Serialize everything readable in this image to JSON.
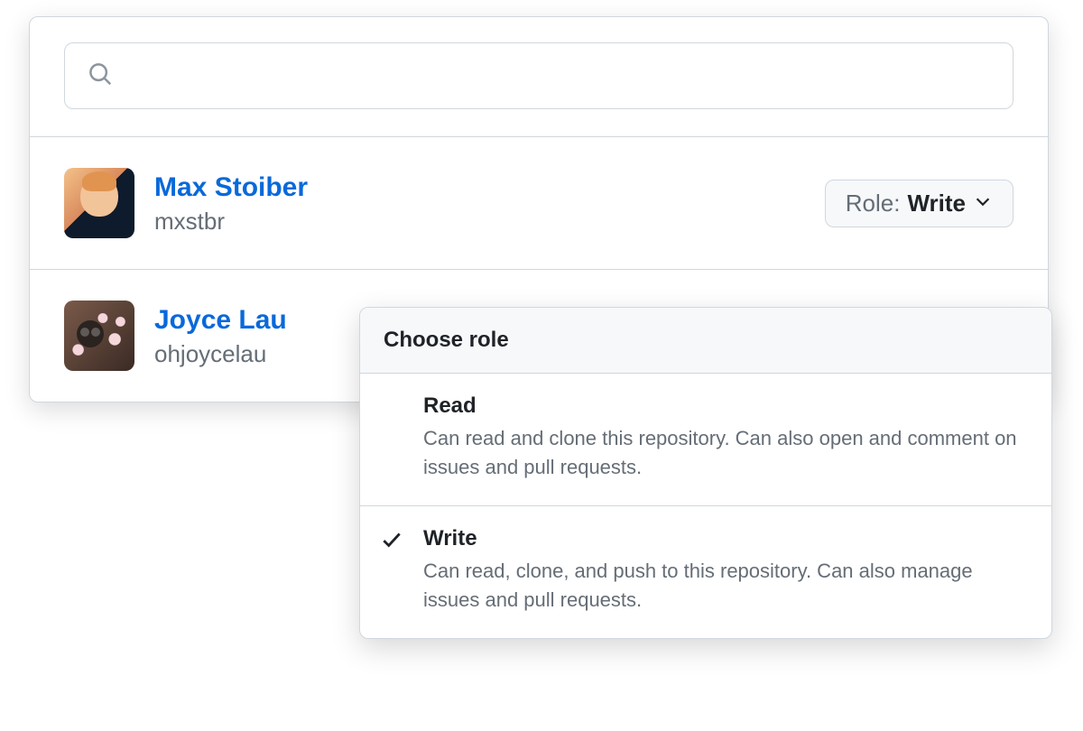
{
  "search": {
    "placeholder": ""
  },
  "users": [
    {
      "name": "Max Stoiber",
      "handle": "mxstbr",
      "role_prefix": "Role: ",
      "role_value": "Write"
    },
    {
      "name": "Joyce Lau",
      "handle": "ohjoycelau"
    }
  ],
  "dropdown": {
    "header": "Choose role",
    "options": [
      {
        "title": "Read",
        "description": "Can read and clone this repository. Can also open and comment on issues and pull requests.",
        "selected": false
      },
      {
        "title": "Write",
        "description": "Can read, clone, and push to this repository. Can also manage issues and pull requests.",
        "selected": true
      }
    ]
  }
}
